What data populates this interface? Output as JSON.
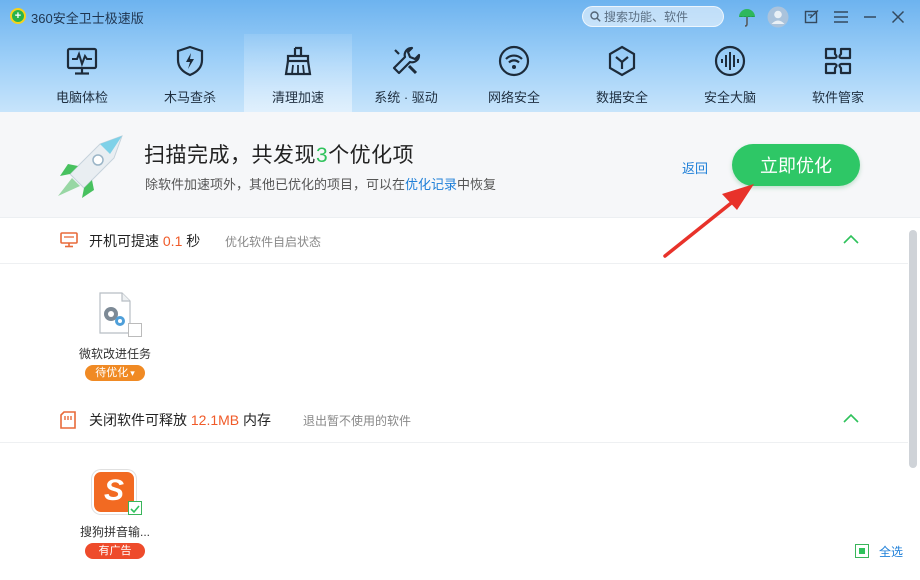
{
  "app": {
    "title": "360安全卫士极速版",
    "logo_glyph": "+"
  },
  "search": {
    "placeholder": "搜索功能、软件"
  },
  "titlebar_icons": [
    "umbrella-icon",
    "avatar-icon",
    "feedback-icon",
    "menu-icon",
    "minimize-icon",
    "close-icon"
  ],
  "nav": {
    "items": [
      {
        "label": "电脑体检",
        "icon": "monitor-pulse-icon"
      },
      {
        "label": "木马查杀",
        "icon": "shield-bolt-icon"
      },
      {
        "label": "清理加速",
        "icon": "broom-icon",
        "active": true
      },
      {
        "label": "系统 · 驱动",
        "icon": "wrench-icon"
      },
      {
        "label": "网络安全",
        "icon": "wifi-icon"
      },
      {
        "label": "数据安全",
        "icon": "hexagon-check-icon"
      },
      {
        "label": "安全大脑",
        "icon": "brain-wave-icon"
      },
      {
        "label": "软件管家",
        "icon": "apps-icon"
      }
    ]
  },
  "result": {
    "title_prefix": "扫描完成，共发现",
    "count": "3",
    "title_suffix": "个优化项",
    "sub_prefix": "除软件加速项外，其他已优化的项目，可以在",
    "sub_link": "优化记录",
    "sub_suffix": "中恢复",
    "back": "返回",
    "optimize": "立即优化"
  },
  "sections": [
    {
      "title_prefix": "开机可提速",
      "value": "0.1",
      "title_suffix": "秒",
      "note": "优化软件自启状态",
      "items": [
        {
          "name": "微软改进任务",
          "badge": "待优化",
          "badge_dropdown": "▾",
          "checked": false
        }
      ]
    },
    {
      "title_prefix": "关闭软件可释放",
      "value": "12.1MB",
      "title_suffix": "内存",
      "note": "退出暂不使用的软件",
      "items": [
        {
          "name": "搜狗拼音输...",
          "badge": "有广告",
          "checked": true,
          "logo_glyph": "S"
        }
      ]
    }
  ],
  "footer": {
    "select_all": "全选"
  },
  "colors": {
    "accent_green": "#2ec766",
    "highlight_orange": "#f05a28",
    "link_blue": "#1e7fd8",
    "annotation_red": "#e8322a"
  }
}
